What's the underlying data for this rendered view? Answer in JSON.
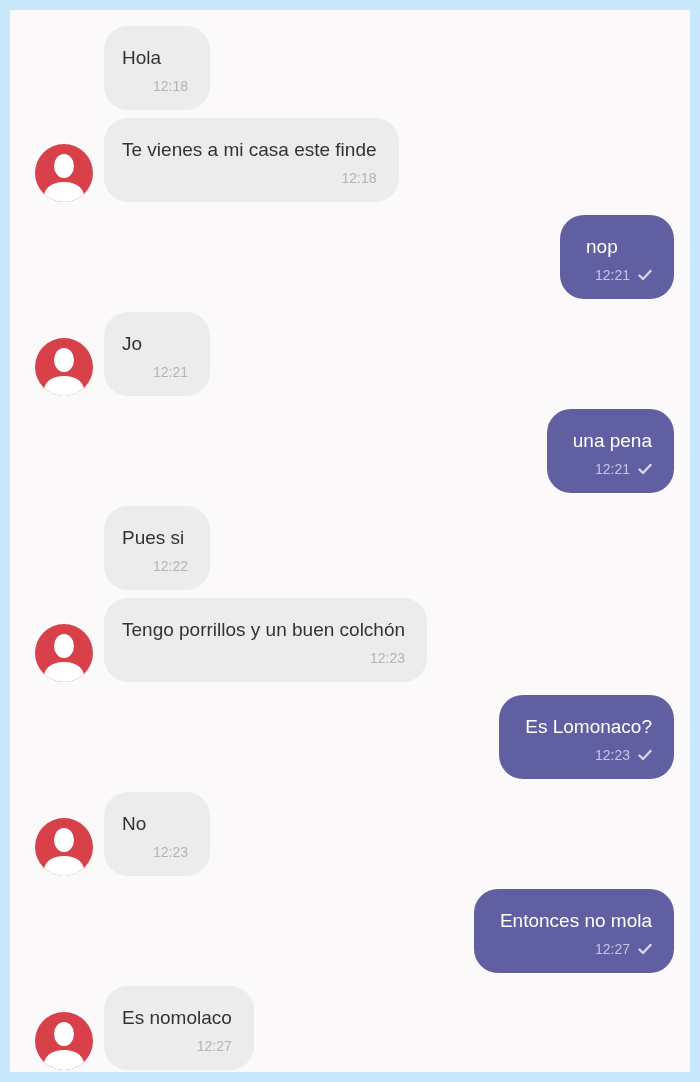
{
  "messages": [
    {
      "kind": "in",
      "text": "Hola",
      "time": "12:18",
      "avatar": false
    },
    {
      "kind": "in",
      "text": "Te vienes a mi casa este finde",
      "time": "12:18",
      "avatar": true
    },
    {
      "kind": "out",
      "text": "nop",
      "time": "12:21",
      "delivered": true
    },
    {
      "kind": "in",
      "text": "Jo",
      "time": "12:21",
      "avatar": true
    },
    {
      "kind": "out",
      "text": "una pena",
      "time": "12:21",
      "delivered": true
    },
    {
      "kind": "in",
      "text": "Pues si",
      "time": "12:22",
      "avatar": false
    },
    {
      "kind": "in",
      "text": "Tengo porrillos y un buen colchón",
      "time": "12:23",
      "avatar": true
    },
    {
      "kind": "out",
      "text": "Es Lomonaco?",
      "time": "12:23",
      "delivered": true
    },
    {
      "kind": "in",
      "text": "No",
      "time": "12:23",
      "avatar": true
    },
    {
      "kind": "out",
      "text": "Entonces no mola",
      "time": "12:27",
      "delivered": true
    },
    {
      "kind": "in",
      "text": "Es nomolaco",
      "time": "12:27",
      "avatar": true
    }
  ]
}
